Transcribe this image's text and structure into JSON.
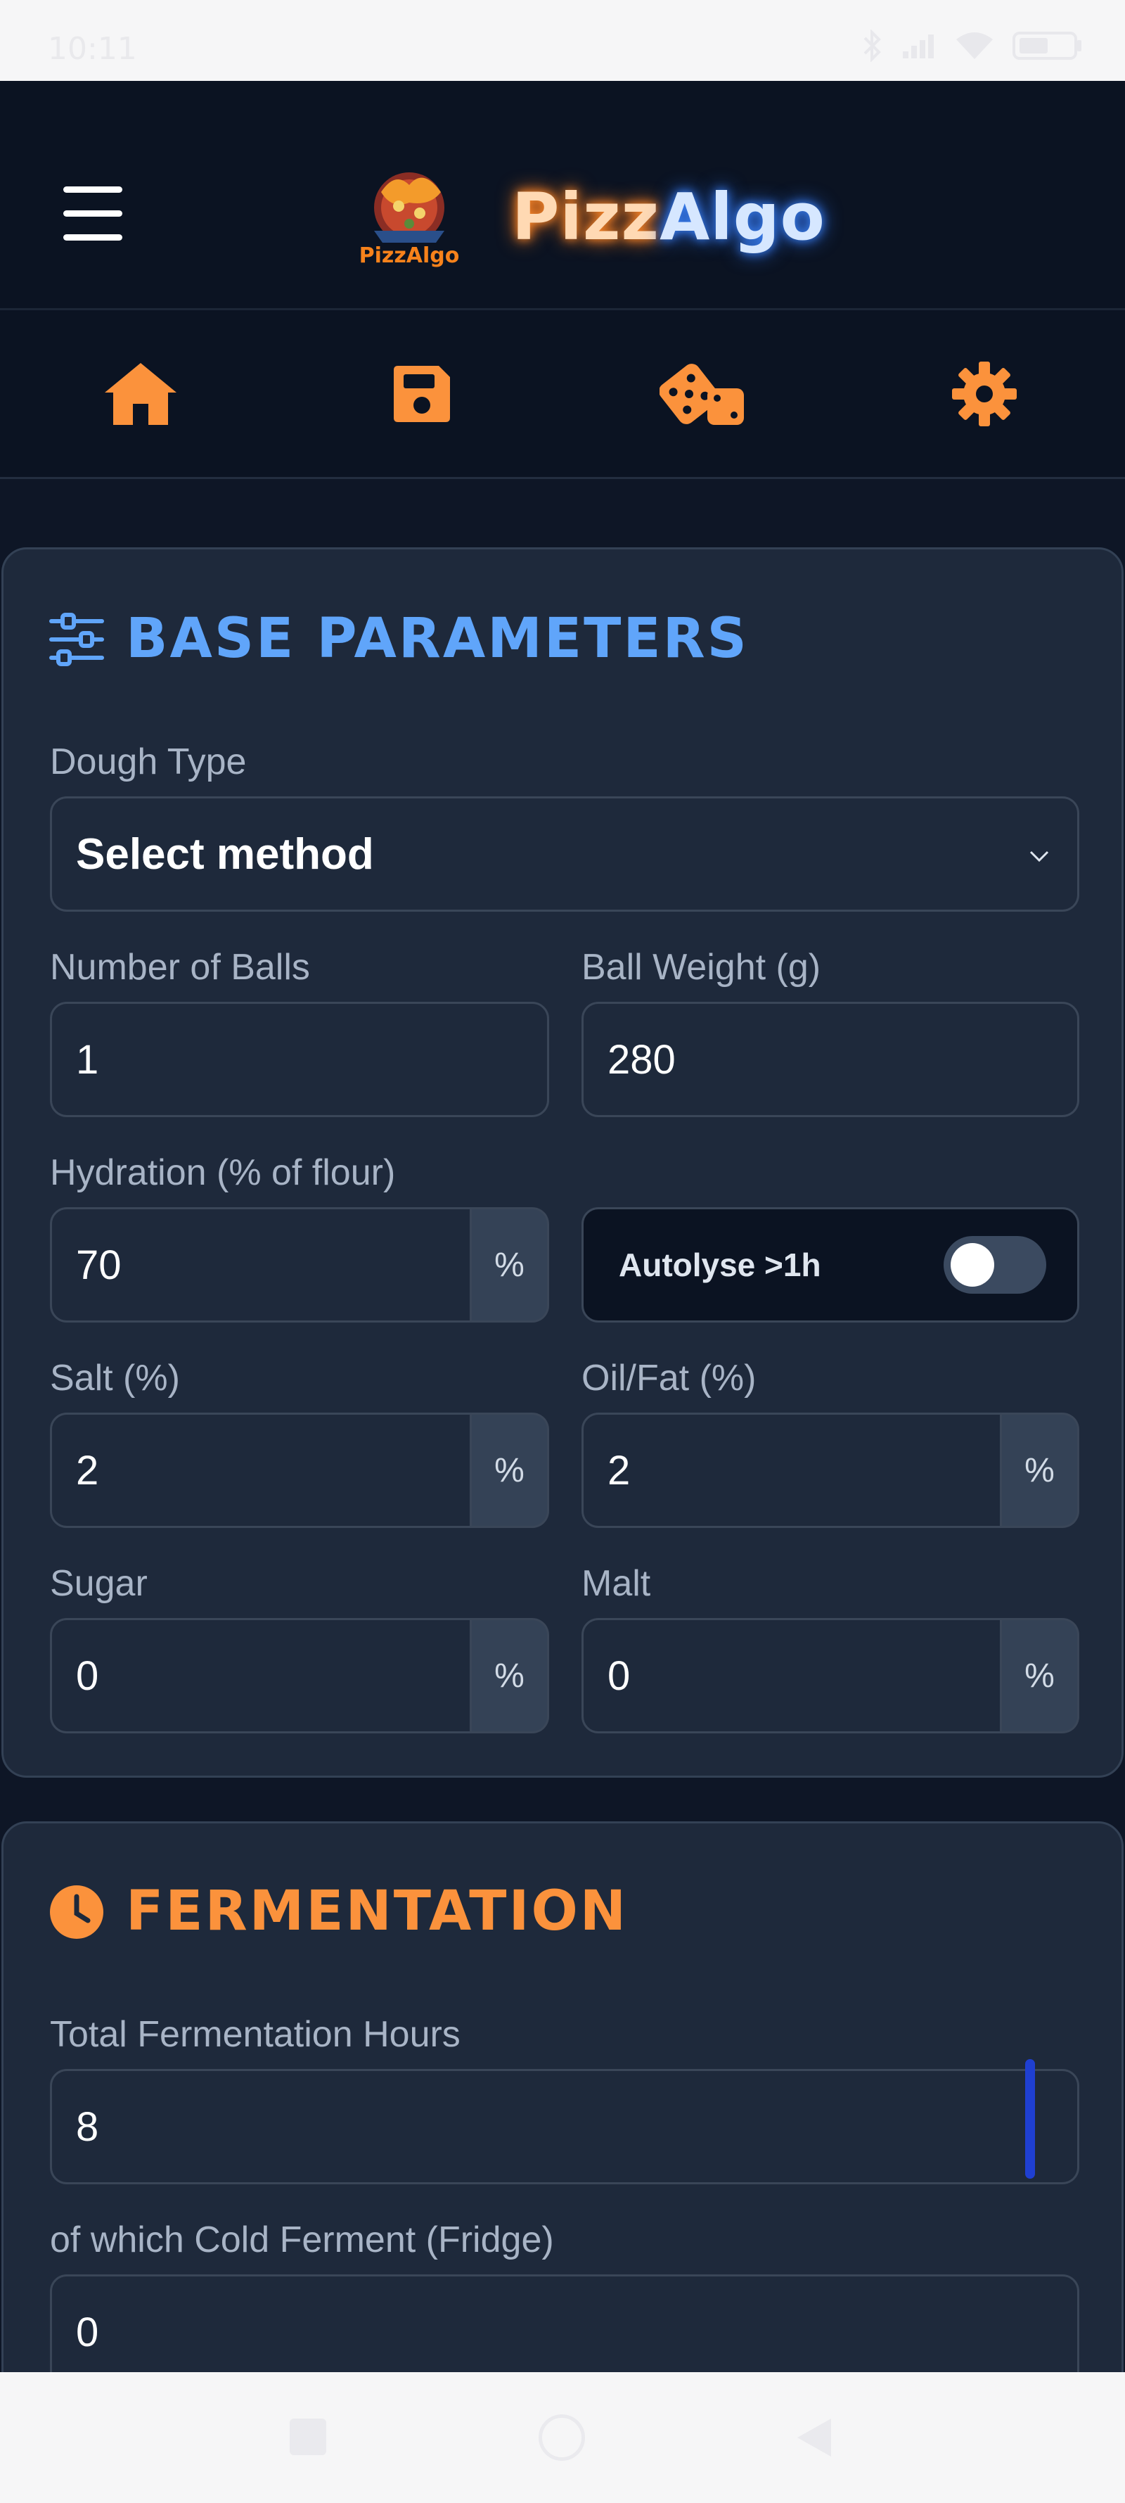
{
  "status_bar": {
    "time": "10:11"
  },
  "header": {
    "logo_text": "PizzAlgo",
    "brand_part1": "Pizz",
    "brand_part2": "Algo",
    "colors": {
      "accent_orange": "#fb923c",
      "accent_blue": "#60a5fa"
    }
  },
  "nav": {
    "items": [
      {
        "icon": "home-icon"
      },
      {
        "icon": "save-icon"
      },
      {
        "icon": "dice-icon"
      },
      {
        "icon": "gear-icon"
      }
    ]
  },
  "base_parameters": {
    "title": "BASE PARAMETERS",
    "dough_type": {
      "label": "Dough Type",
      "value": "Select method"
    },
    "number_of_balls": {
      "label": "Number of Balls",
      "value": "1"
    },
    "ball_weight": {
      "label": "Ball Weight (g)",
      "value": "280"
    },
    "hydration": {
      "label": "Hydration (% of flour)",
      "value": "70",
      "unit": "%"
    },
    "autolyse": {
      "label": "Autolyse >1h",
      "enabled": false
    },
    "salt": {
      "label": "Salt (%)",
      "value": "2",
      "unit": "%"
    },
    "oil": {
      "label": "Oil/Fat (%)",
      "value": "2",
      "unit": "%"
    },
    "sugar": {
      "label": "Sugar",
      "value": "0",
      "unit": "%"
    },
    "malt": {
      "label": "Malt",
      "value": "0",
      "unit": "%"
    }
  },
  "fermentation": {
    "title": "FERMENTATION",
    "total_hours": {
      "label": "Total Fermentation Hours",
      "value": "8"
    },
    "cold_ferment": {
      "label": "of which Cold Ferment (Fridge)",
      "value": "0"
    }
  }
}
